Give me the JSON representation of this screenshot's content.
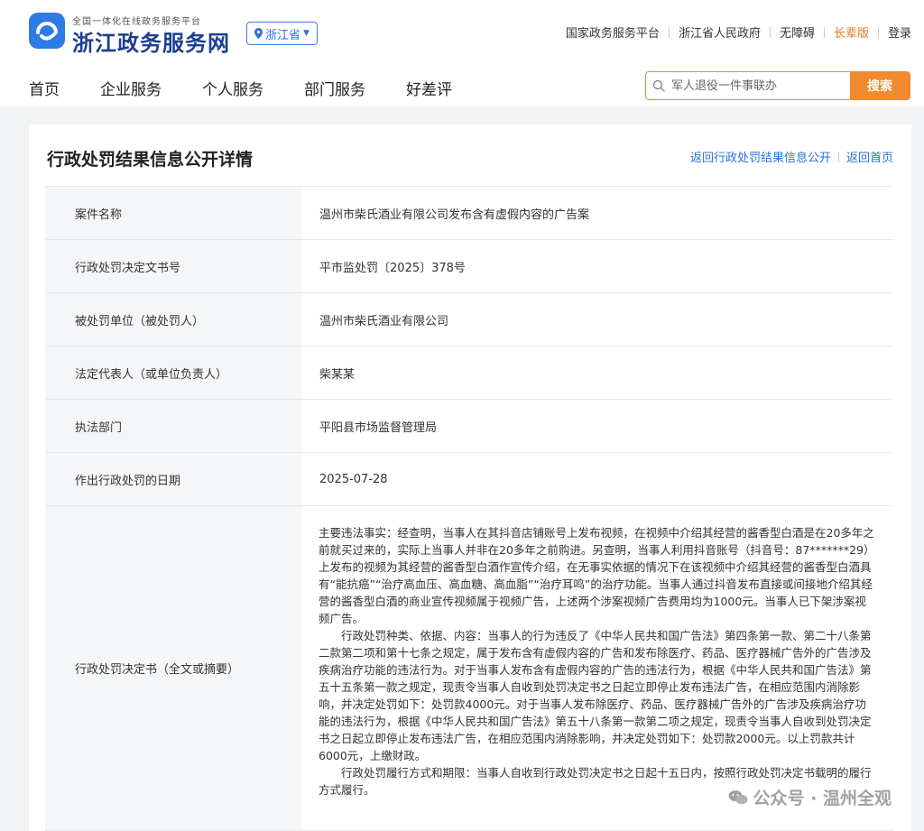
{
  "header": {
    "subtitle": "全国一体化在线政务服务平台",
    "site_name": "浙江政务服务网",
    "region": "浙江省",
    "top_links": [
      "国家政务服务平台",
      "浙江省人民政府",
      "无障碍",
      "长辈版",
      "登录"
    ],
    "nav": [
      "首页",
      "企业服务",
      "个人服务",
      "部门服务",
      "好差评"
    ],
    "search_placeholder": "军人退役一件事联办",
    "search_button": "搜索"
  },
  "main": {
    "title": "行政处罚结果信息公开详情",
    "links": [
      "返回行政处罚结果信息公开",
      "返回首页"
    ],
    "rows": [
      {
        "label": "案件名称",
        "value": "温州市柴氏酒业有限公司发布含有虚假内容的广告案"
      },
      {
        "label": "行政处罚决定文书号",
        "value": "平市监处罚〔2025〕378号"
      },
      {
        "label": "被处罚单位（被处罚人）",
        "value": "温州市柴氏酒业有限公司"
      },
      {
        "label": "法定代表人（或单位负责人）",
        "value": "柴某某"
      },
      {
        "label": "执法部门",
        "value": "平阳县市场监督管理局"
      },
      {
        "label": "作出行政处罚的日期",
        "value": "2025-07-28"
      }
    ],
    "decision": {
      "label": "行政处罚决定书（全文或摘要）",
      "paragraphs": [
        "主要违法事实：经查明，当事人在其抖音店铺账号上发布视频，在视频中介绍其经营的酱香型白酒是在20多年之前就买过来的，实际上当事人并非在20多年之前购进。另查明，当事人利用抖音账号（抖音号：87*******29）上发布的视频为其经营的酱香型白酒作宣传介绍，在无事实依据的情况下在该视频中介绍其经营的酱香型白酒具有“能抗癌”“治疗高血压、高血糖、高血脂”“治疗耳鸣”的治疗功能。当事人通过抖音发布直接或间接地介绍其经营的酱香型白酒的商业宣传视频属于视频广告，上述两个涉案视频广告费用均为1000元。当事人已下架涉案视频广告。",
        "行政处罚种类、依据、内容：当事人的行为违反了《中华人民共和国广告法》第四条第一款、第二十八条第二款第二项和第十七条之规定，属于发布含有虚假内容的广告和发布除医疗、药品、医疗器械广告外的广告涉及疾病治疗功能的违法行为。对于当事人发布含有虚假内容的广告的违法行为，根据《中华人民共和国广告法》第五十五条第一款之规定，现责令当事人自收到处罚决定书之日起立即停止发布违法广告，在相应范围内消除影响，并决定处罚如下：处罚款4000元。对于当事人发布除医疗、药品、医疗器械广告外的广告涉及疾病治疗功能的违法行为，根据《中华人民共和国广告法》第五十八条第一款第二项之规定，现责令当事人自收到处罚决定书之日起立即停止发布违法广告，在相应范围内消除影响，并决定处罚如下：处罚款2000元。以上罚款共计6000元，上缴财政。",
        "行政处罚履行方式和期限：当事人自收到行政处罚决定书之日起十五日内，按照行政处罚决定书载明的履行方式履行。"
      ]
    }
  },
  "watermark": "公众号 · 温州全观",
  "colors": {
    "brand": "#2f7be5",
    "accent": "#f08a2e",
    "link": "#2c6fd6"
  }
}
